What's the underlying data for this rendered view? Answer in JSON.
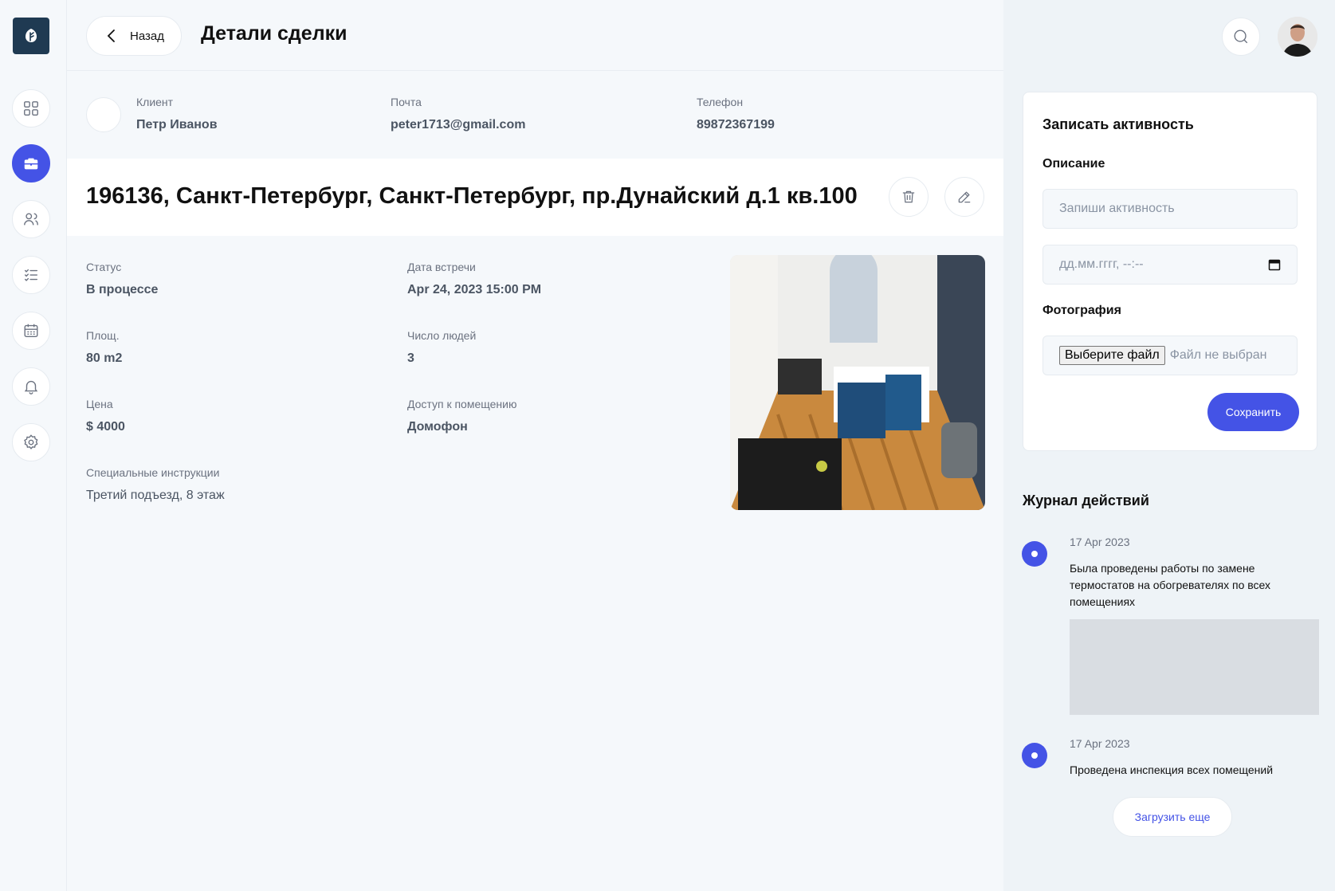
{
  "header": {
    "back_label": "Назад",
    "title": "Детали сделки"
  },
  "sidebar": {
    "items": [
      {
        "icon": "dashboard-icon"
      },
      {
        "icon": "briefcase-icon",
        "active": true
      },
      {
        "icon": "users-icon"
      },
      {
        "icon": "checklist-icon"
      },
      {
        "icon": "calendar-icon"
      },
      {
        "icon": "bell-icon"
      },
      {
        "icon": "settings-icon"
      }
    ]
  },
  "client": {
    "client_label": "Клиент",
    "client_value": "Петр Иванов",
    "email_label": "Почта",
    "email_value": "peter1713@gmail.com",
    "phone_label": "Телефон",
    "phone_value": "89872367199"
  },
  "deal": {
    "address": "196136, Санкт-Петербург, Санкт-Петербург, пр.Дунайский д.1 кв.100",
    "status_label": "Статус",
    "status_value": "В процессе",
    "meeting_label": "Дата встречи",
    "meeting_value": "Apr 24, 2023 15:00 PM",
    "area_label": "Площ.",
    "area_value": "80 m2",
    "people_label": "Число людей",
    "people_value": "3",
    "price_label": "Цена",
    "price_value": "$ 4000",
    "access_label": "Доступ к помещению",
    "access_value": "Домофон",
    "instructions_label": "Специальные инструкции",
    "instructions_value": "Третий подъезд, 8 этаж"
  },
  "activity_form": {
    "title": "Записать активность",
    "description_label": "Описание",
    "description_placeholder": "Запиши активность",
    "date_placeholder": "дд.мм.гггг, --:--",
    "photo_label": "Фотография",
    "file_button": "Выберите файл",
    "file_status": "Файл не выбран",
    "save_label": "Сохранить"
  },
  "log": {
    "title": "Журнал действий",
    "entries": [
      {
        "date": "17 Apr 2023",
        "text": "Была проведены работы по замене термостатов на обогревателях по всех помещениях"
      },
      {
        "date": "17 Apr 2023",
        "text": "Проведена инспекция всех помещений"
      }
    ],
    "load_more": "Загрузить еще"
  },
  "colors": {
    "accent": "#4453e6",
    "logo_bg": "#1f3a52",
    "page_bg": "#f5f8fb"
  }
}
